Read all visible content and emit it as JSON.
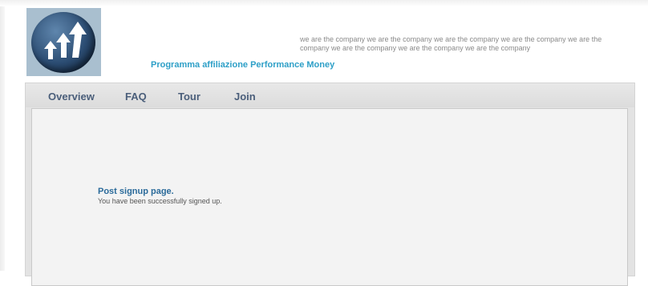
{
  "header": {
    "logo_icon": "rising-arrows-logo-icon",
    "tagline": "we are the company we are the company we are the company we are the company we are the company we are the company we are the company we are the company",
    "site_title": "Programma affiliazione Performance Money"
  },
  "nav": {
    "items": [
      {
        "label": "Overview"
      },
      {
        "label": "FAQ"
      },
      {
        "label": "Tour"
      },
      {
        "label": "Join"
      }
    ]
  },
  "main": {
    "heading": "Post signup page.",
    "message": "You have been successfully signed up."
  }
}
